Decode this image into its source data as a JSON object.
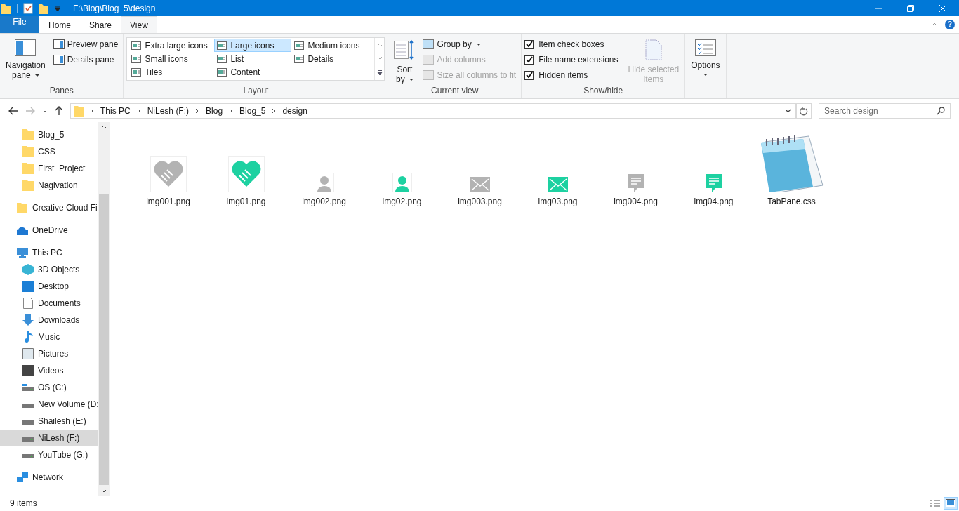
{
  "window": {
    "title": "F:\\Blog\\Blog_5\\design"
  },
  "help": "?",
  "tabs": [
    {
      "label": "File",
      "kind": "file",
      "selected": false
    },
    {
      "label": "Home",
      "kind": "tab",
      "selected": false
    },
    {
      "label": "Share",
      "kind": "tab",
      "selected": false
    },
    {
      "label": "View",
      "kind": "tab",
      "selected": true
    }
  ],
  "ribbon": {
    "panes": {
      "label": "Panes",
      "navigation_pane": "Navigation",
      "navigation_pane_2": "pane",
      "items": [
        "Preview pane",
        "Details pane"
      ]
    },
    "layout": {
      "label": "Layout",
      "options": [
        {
          "label": "Extra large icons",
          "selected": false
        },
        {
          "label": "Large icons",
          "selected": true
        },
        {
          "label": "Medium icons",
          "selected": false
        },
        {
          "label": "Small icons",
          "selected": false
        },
        {
          "label": "List",
          "selected": false
        },
        {
          "label": "Details",
          "selected": false
        },
        {
          "label": "Tiles",
          "selected": false
        },
        {
          "label": "Content",
          "selected": false
        }
      ]
    },
    "current_view": {
      "label": "Current view",
      "sort_by": "Sort",
      "sort_by_2": "by",
      "items": [
        {
          "label": "Group by",
          "disabled": false
        },
        {
          "label": "Add columns",
          "disabled": true
        },
        {
          "label": "Size all columns to fit",
          "disabled": true
        }
      ]
    },
    "show_hide": {
      "label": "Show/hide",
      "checkboxes": [
        {
          "label": "Item check boxes",
          "checked": true
        },
        {
          "label": "File name extensions",
          "checked": true
        },
        {
          "label": "Hidden items",
          "checked": true
        }
      ],
      "hide_selected": {
        "label": "Hide selected",
        "label_2": "items",
        "disabled": true
      }
    },
    "options": {
      "label": "Options"
    }
  },
  "address": {
    "crumbs": [
      "This PC",
      "NiLesh (F:)",
      "Blog",
      "Blog_5",
      "design"
    ]
  },
  "search": {
    "placeholder": "Search design"
  },
  "nav": [
    {
      "children": [
        {
          "label": "Blog_5",
          "kind": "folder",
          "selected": false
        },
        {
          "label": "CSS",
          "kind": "folder",
          "selected": false
        },
        {
          "label": "First_Project",
          "kind": "folder",
          "selected": false
        },
        {
          "label": "Nagivation",
          "kind": "folder",
          "selected": false
        }
      ]
    },
    {
      "label": "Creative Cloud Fil",
      "kind": "cloud-folder",
      "selected": false
    },
    {
      "label": "OneDrive",
      "kind": "onedrive",
      "selected": false
    },
    {
      "label": "This PC",
      "kind": "pc",
      "selected": false,
      "children": [
        {
          "label": "3D Objects",
          "kind": "cube",
          "selected": false
        },
        {
          "label": "Desktop",
          "kind": "desktop",
          "selected": false
        },
        {
          "label": "Documents",
          "kind": "document",
          "selected": false
        },
        {
          "label": "Downloads",
          "kind": "download",
          "selected": false
        },
        {
          "label": "Music",
          "kind": "music",
          "selected": false
        },
        {
          "label": "Pictures",
          "kind": "pictures",
          "selected": false
        },
        {
          "label": "Videos",
          "kind": "videos",
          "selected": false
        },
        {
          "label": "OS (C:)",
          "kind": "os-drive",
          "selected": false
        },
        {
          "label": "New Volume (D:",
          "kind": "drive",
          "selected": false
        },
        {
          "label": "Shailesh (E:)",
          "kind": "drive",
          "selected": false
        },
        {
          "label": "NiLesh (F:)",
          "kind": "drive",
          "selected": true
        },
        {
          "label": "YouTube (G:)",
          "kind": "drive",
          "selected": false
        }
      ]
    },
    {
      "label": "Network",
      "kind": "network",
      "selected": false
    }
  ],
  "files": [
    {
      "name": "img001.png",
      "kind": "heart",
      "color": "#b3b3b3"
    },
    {
      "name": "img01.png",
      "kind": "heart",
      "color": "#1dd1a1"
    },
    {
      "name": "img002.png",
      "kind": "person",
      "color": "#b3b3b3"
    },
    {
      "name": "img02.png",
      "kind": "person",
      "color": "#1dd1a1"
    },
    {
      "name": "img003.png",
      "kind": "mail",
      "color": "#b3b3b3"
    },
    {
      "name": "img03.png",
      "kind": "mail",
      "color": "#1dd1a1"
    },
    {
      "name": "img004.png",
      "kind": "chat",
      "color": "#b3b3b3"
    },
    {
      "name": "img04.png",
      "kind": "chat",
      "color": "#1dd1a1"
    },
    {
      "name": "TabPane.css",
      "kind": "notepad"
    }
  ],
  "status_bar": {
    "count": "9 items",
    "views": [
      {
        "kind": "details",
        "selected": false
      },
      {
        "kind": "large-icons",
        "selected": true
      }
    ]
  }
}
